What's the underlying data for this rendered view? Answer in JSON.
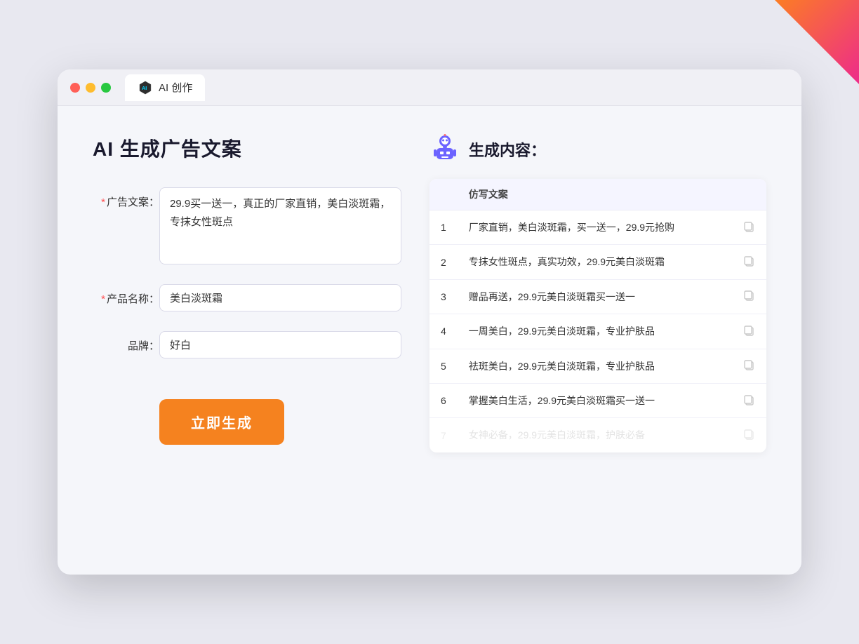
{
  "browser": {
    "tab_label": "AI 创作"
  },
  "page": {
    "title": "AI 生成广告文案"
  },
  "form": {
    "ad_label": "广告文案：",
    "ad_required": "*",
    "ad_value": "29.9买一送一，真正的厂家直销，美白淡斑霜，专抹女性斑点",
    "product_label": "产品名称：",
    "product_required": "*",
    "product_value": "美白淡斑霜",
    "brand_label": "品牌：",
    "brand_value": "好白",
    "generate_btn": "立即生成"
  },
  "result": {
    "header": "生成内容：",
    "col_label": "仿写文案",
    "items": [
      {
        "num": "1",
        "text": "厂家直销，美白淡斑霜，买一送一，29.9元抢购"
      },
      {
        "num": "2",
        "text": "专抹女性斑点，真实功效，29.9元美白淡斑霜"
      },
      {
        "num": "3",
        "text": "赠品再送，29.9元美白淡斑霜买一送一"
      },
      {
        "num": "4",
        "text": "一周美白，29.9元美白淡斑霜，专业护肤品"
      },
      {
        "num": "5",
        "text": "祛斑美白，29.9元美白淡斑霜，专业护肤品"
      },
      {
        "num": "6",
        "text": "掌握美白生活，29.9元美白淡斑霜买一送一"
      },
      {
        "num": "7",
        "text": "女神必备，29.9元美白淡斑霜，护肤必备",
        "faded": true
      }
    ]
  }
}
